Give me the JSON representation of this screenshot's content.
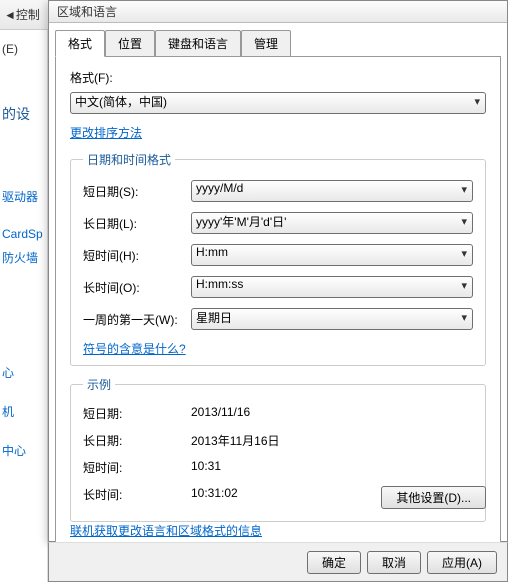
{
  "background": {
    "toolbar_item": "控制",
    "edit_menu": "(E)",
    "left_items": [
      "的设",
      "驱动器",
      "CardSp",
      "防火墙",
      "心",
      "机",
      "中心"
    ]
  },
  "dialog": {
    "title": "区域和语言",
    "tabs": [
      "格式",
      "位置",
      "键盘和语言",
      "管理"
    ],
    "format_label": "格式(F):",
    "format_value": "中文(简体，中国)",
    "sort_link": "更改排序方法",
    "datetime_legend": "日期和时间格式",
    "fields": {
      "short_date": {
        "label": "短日期(S):",
        "value": "yyyy/M/d"
      },
      "long_date": {
        "label": "长日期(L):",
        "value": "yyyy'年'M'月'd'日'"
      },
      "short_time": {
        "label": "短时间(H):",
        "value": "H:mm"
      },
      "long_time": {
        "label": "长时间(O):",
        "value": "H:mm:ss"
      },
      "first_day": {
        "label": "一周的第一天(W):",
        "value": "星期日"
      }
    },
    "notation_link": "符号的含意是什么?",
    "sample_legend": "示例",
    "samples": {
      "short_date": {
        "label": "短日期:",
        "value": "2013/11/16"
      },
      "long_date": {
        "label": "长日期:",
        "value": "2013年11月16日"
      },
      "short_time": {
        "label": "短时间:",
        "value": "10:31"
      },
      "long_time": {
        "label": "长时间:",
        "value": "10:31:02"
      }
    },
    "other_settings": "其他设置(D)...",
    "online_link": "联机获取更改语言和区域格式的信息",
    "buttons": {
      "ok": "确定",
      "cancel": "取消",
      "apply": "应用(A)"
    }
  }
}
